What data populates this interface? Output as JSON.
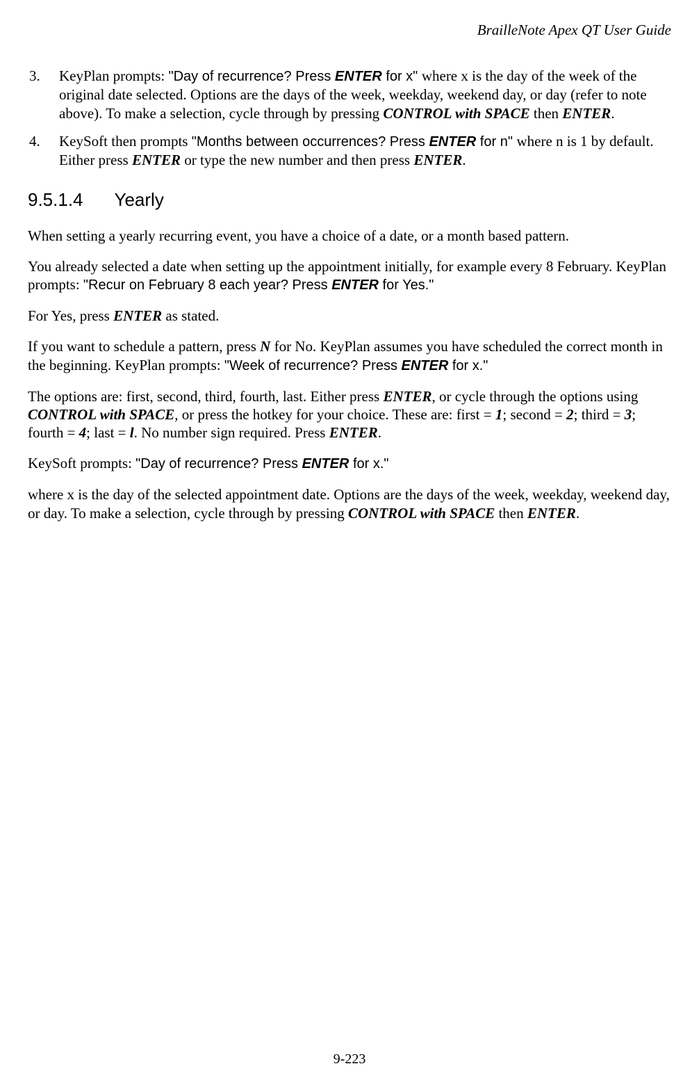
{
  "header": {
    "title": "BrailleNote Apex QT User Guide"
  },
  "list": {
    "item3": {
      "num": "3.",
      "t1": " KeyPlan prompts: ",
      "q1a": "\"Day of recurrence? Press ",
      "q1b": "ENTER",
      "q1c": " for x\" ",
      "t2": "where x is the day of the week of the original date selected. Options are the days of the week, weekday, weekend day, or day (refer to note above). To make a selection, cycle through by pressing ",
      "k1": "CONTROL with SPACE",
      "t3": " then ",
      "k2": "ENTER",
      "t4": "."
    },
    "item4": {
      "num": "4.",
      "t1": " KeySoft then prompts ",
      "q1a": "\"Months between occurrences? Press ",
      "q1b": "ENTER",
      "q1c": " for n\" ",
      "t2": "where n is 1 by default. Either press ",
      "k1": "ENTER",
      "t3": " or type the new number and then press ",
      "k2": "ENTER",
      "t4": "."
    }
  },
  "section": {
    "num": "9.5.1.4",
    "title": "Yearly"
  },
  "p1": "When setting a yearly recurring event, you have a choice of a date, or a month based pattern.",
  "p2": {
    "t1": "You already selected a date when setting up the appointment initially, for example every 8 February. KeyPlan prompts: ",
    "q1a": "\"Recur on February 8 each year? Press ",
    "q1b": "ENTER",
    "q1c": " for Yes.\""
  },
  "p3": {
    "t1": "For Yes, press ",
    "k1": "ENTER",
    "t2": " as stated."
  },
  "p4": {
    "t1": "If you want to schedule a pattern, press ",
    "k1": "N",
    "t2": " for No. KeyPlan assumes you have scheduled the correct month in the beginning. KeyPlan prompts: ",
    "q1a": "\"Week of recurrence? Press ",
    "q1b": "ENTER",
    "q1c": " for x.\""
  },
  "p5": {
    "t1": "The options are: first, second, third, fourth, last. Either press ",
    "k1": "ENTER",
    "t2": ", or cycle through the options using ",
    "k2": "CONTROL with SPACE",
    "t3": ", or press the hotkey for your choice. These are: first = ",
    "k3": "1",
    "t4": "; second = ",
    "k4": "2",
    "t5": "; third = ",
    "k5": "3",
    "t6": "; fourth = ",
    "k6": "4",
    "t7": "; last = ",
    "k7": "l",
    "t8": ". No number sign required. Press ",
    "k8": "ENTER",
    "t9": "."
  },
  "p6": {
    "t1": "KeySoft prompts: ",
    "q1a": "\"Day of recurrence? Press ",
    "q1b": "ENTER",
    "q1c": " for x.\""
  },
  "p7": {
    "t1": "where x is the day of the selected appointment date. Options are the days of the week, weekday, weekend day, or day. To make a selection, cycle through by pressing ",
    "k1": "CONTROL with SPACE",
    "t2": " then ",
    "k2": "ENTER",
    "t3": "."
  },
  "footer": {
    "page": "9-223"
  }
}
